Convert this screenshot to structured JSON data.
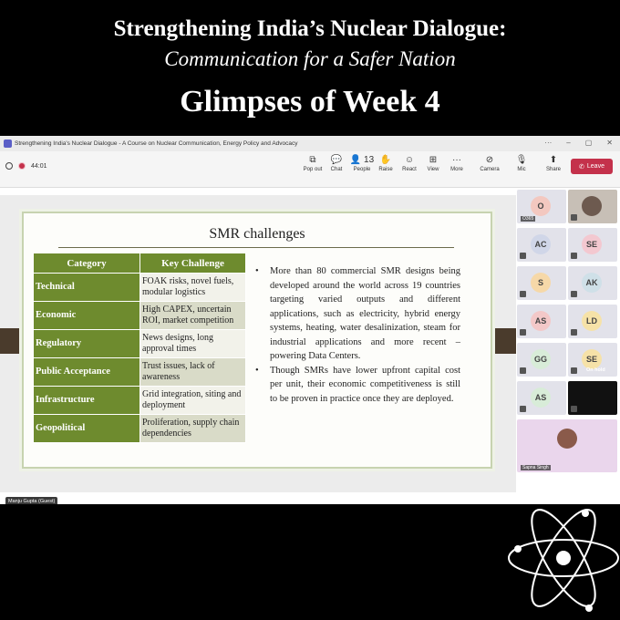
{
  "poster": {
    "title_line1": "Strengthening India’s Nuclear Dialogue:",
    "title_line2": "Communication for a Safer Nation",
    "title_line3": "Glimpses of Week 4"
  },
  "window": {
    "title": "Strengthening India's Nuclear Dialogue - A Course on Nuclear Communication, Energy Policy and Advocacy",
    "controls": [
      "···",
      "–",
      "▢",
      "✕"
    ]
  },
  "toolbar": {
    "timer": "44:01",
    "buttons": [
      {
        "label": "Pop out",
        "icon": "popout-icon",
        "glyph": "⧉"
      },
      {
        "label": "Chat",
        "icon": "chat-icon",
        "glyph": "💬"
      },
      {
        "label": "People",
        "icon": "people-icon",
        "glyph": "👤",
        "count": "13"
      },
      {
        "label": "Raise",
        "icon": "raise-hand-icon",
        "glyph": "✋"
      },
      {
        "label": "React",
        "icon": "react-icon",
        "glyph": "☺"
      },
      {
        "label": "View",
        "icon": "view-icon",
        "glyph": "⊞"
      },
      {
        "label": "More",
        "icon": "more-icon",
        "glyph": "···"
      },
      {
        "label": "Camera",
        "icon": "camera-off-icon",
        "glyph": "⊘"
      },
      {
        "label": "Mic",
        "icon": "mic-off-icon",
        "glyph": "🎙"
      },
      {
        "label": "Share",
        "icon": "share-icon",
        "glyph": "⬆"
      }
    ],
    "leave_label": "Leave",
    "leave_color": "#c4314b"
  },
  "slide": {
    "title": "SMR challenges",
    "table_headers": [
      "Category",
      "Key Challenge"
    ],
    "rows": [
      {
        "category": "Technical",
        "challenge": "FOAK risks, novel fuels, modular logistics"
      },
      {
        "category": "Economic",
        "challenge": "High CAPEX, uncertain ROI, market competition"
      },
      {
        "category": "Regulatory",
        "challenge": "News designs, long approval times"
      },
      {
        "category": "Public Acceptance",
        "challenge": "Trust issues, lack of awareness"
      },
      {
        "category": "Infrastructure",
        "challenge": "Grid integration, siting and deployment"
      },
      {
        "category": "Geopolitical",
        "challenge": "Proliferation, supply chain dependencies"
      }
    ],
    "bullets": [
      "More than 80 commercial SMR designs being developed around the world across 19 countries targeting varied outputs and different applications, such as electricity, hybrid energy systems, heating, water desalinization, steam for industrial applications and more recent – powering Data Centers.",
      "Though SMRs have lower upfront capital cost per unit, their economic competitiveness is still to be proven in practice once they are deployed."
    ],
    "accent_color": "#6e8b2e"
  },
  "presenter_tag": "Manju Gupta (Guest)",
  "participants": [
    {
      "initials": "O",
      "name": "O365",
      "color": "#f3c8c0"
    },
    {
      "initials": "",
      "name": "",
      "video": true
    },
    {
      "initials": "AC",
      "name": "",
      "color": "#d0d6e8"
    },
    {
      "initials": "SE",
      "name": "",
      "color": "#f3c8d0"
    },
    {
      "initials": "S",
      "name": "",
      "color": "#f6d8a8"
    },
    {
      "initials": "AK",
      "name": "",
      "color": "#cfe0e8"
    },
    {
      "initials": "AS",
      "name": "",
      "color": "#f3c8c8"
    },
    {
      "initials": "LD",
      "name": "",
      "color": "#f6e2a8"
    },
    {
      "initials": "GG",
      "name": "",
      "color": "#d8ecd8"
    },
    {
      "initials": "SE",
      "name": "",
      "color": "#f6e2a8",
      "status": "On hold"
    },
    {
      "initials": "AS",
      "name": "",
      "color": "#d8ecd8"
    },
    {
      "initials": "",
      "name": "",
      "dark": true
    },
    {
      "initials": "",
      "name": "Sapna Singh",
      "photo": true
    }
  ]
}
